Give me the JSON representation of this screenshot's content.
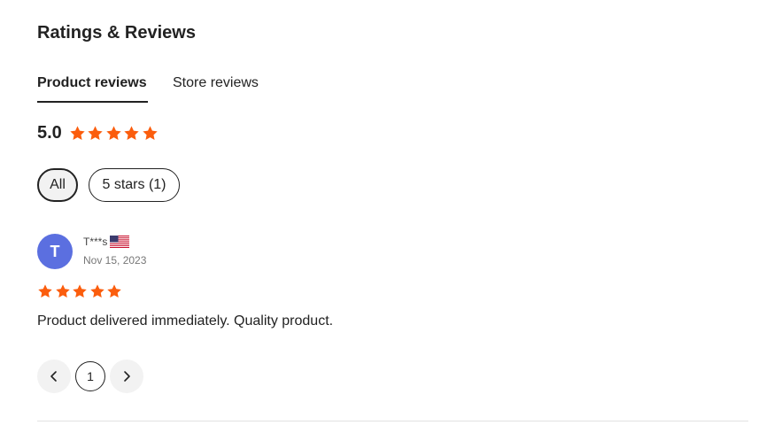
{
  "section": {
    "title": "Ratings & Reviews"
  },
  "tabs": [
    {
      "label": "Product reviews",
      "active": true
    },
    {
      "label": "Store reviews",
      "active": false
    }
  ],
  "summary": {
    "score": "5.0",
    "stars": 5,
    "star_color": "#fb5d0d"
  },
  "filters": [
    {
      "label": "All",
      "active": true
    },
    {
      "label": "5 stars (1)",
      "active": false
    }
  ],
  "reviews": [
    {
      "avatar_initial": "T",
      "avatar_color": "#5b6fe0",
      "name": "T***s",
      "country_icon": "us-flag-icon",
      "date": "Nov 15, 2023",
      "rating": 5,
      "text": "Product delivered immediately. Quality product."
    }
  ],
  "pagination": {
    "current_page": "1",
    "prev_icon": "chevron-left-icon",
    "next_icon": "chevron-right-icon"
  }
}
